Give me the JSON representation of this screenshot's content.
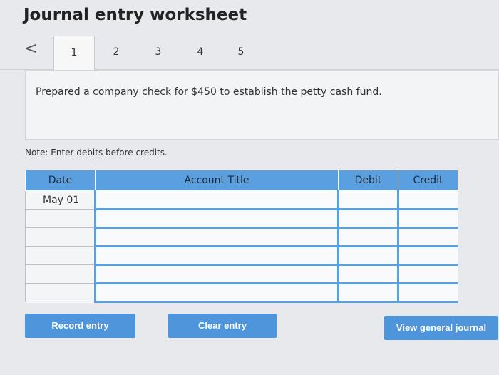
{
  "header": {
    "title": "Journal entry worksheet"
  },
  "tabs": {
    "back_glyph": "<",
    "items": [
      {
        "label": "1",
        "active": true
      },
      {
        "label": "2",
        "active": false
      },
      {
        "label": "3",
        "active": false
      },
      {
        "label": "4",
        "active": false
      },
      {
        "label": "5",
        "active": false
      }
    ]
  },
  "prompt": {
    "text": "Prepared a company check for $450 to establish the petty cash fund."
  },
  "note": "Note: Enter debits before credits.",
  "table": {
    "headers": {
      "date": "Date",
      "account": "Account Title",
      "debit": "Debit",
      "credit": "Credit"
    },
    "rows": [
      {
        "date": "May 01",
        "account": "",
        "debit": "",
        "credit": ""
      },
      {
        "date": "",
        "account": "",
        "debit": "",
        "credit": ""
      },
      {
        "date": "",
        "account": "",
        "debit": "",
        "credit": ""
      },
      {
        "date": "",
        "account": "",
        "debit": "",
        "credit": ""
      },
      {
        "date": "",
        "account": "",
        "debit": "",
        "credit": ""
      },
      {
        "date": "",
        "account": "",
        "debit": "",
        "credit": ""
      }
    ]
  },
  "buttons": {
    "record": "Record entry",
    "clear": "Clear entry",
    "view": "View general journal"
  },
  "colors": {
    "accent": "#4f95dc",
    "header": "#5aa0e0",
    "background": "#e8e9ec"
  }
}
